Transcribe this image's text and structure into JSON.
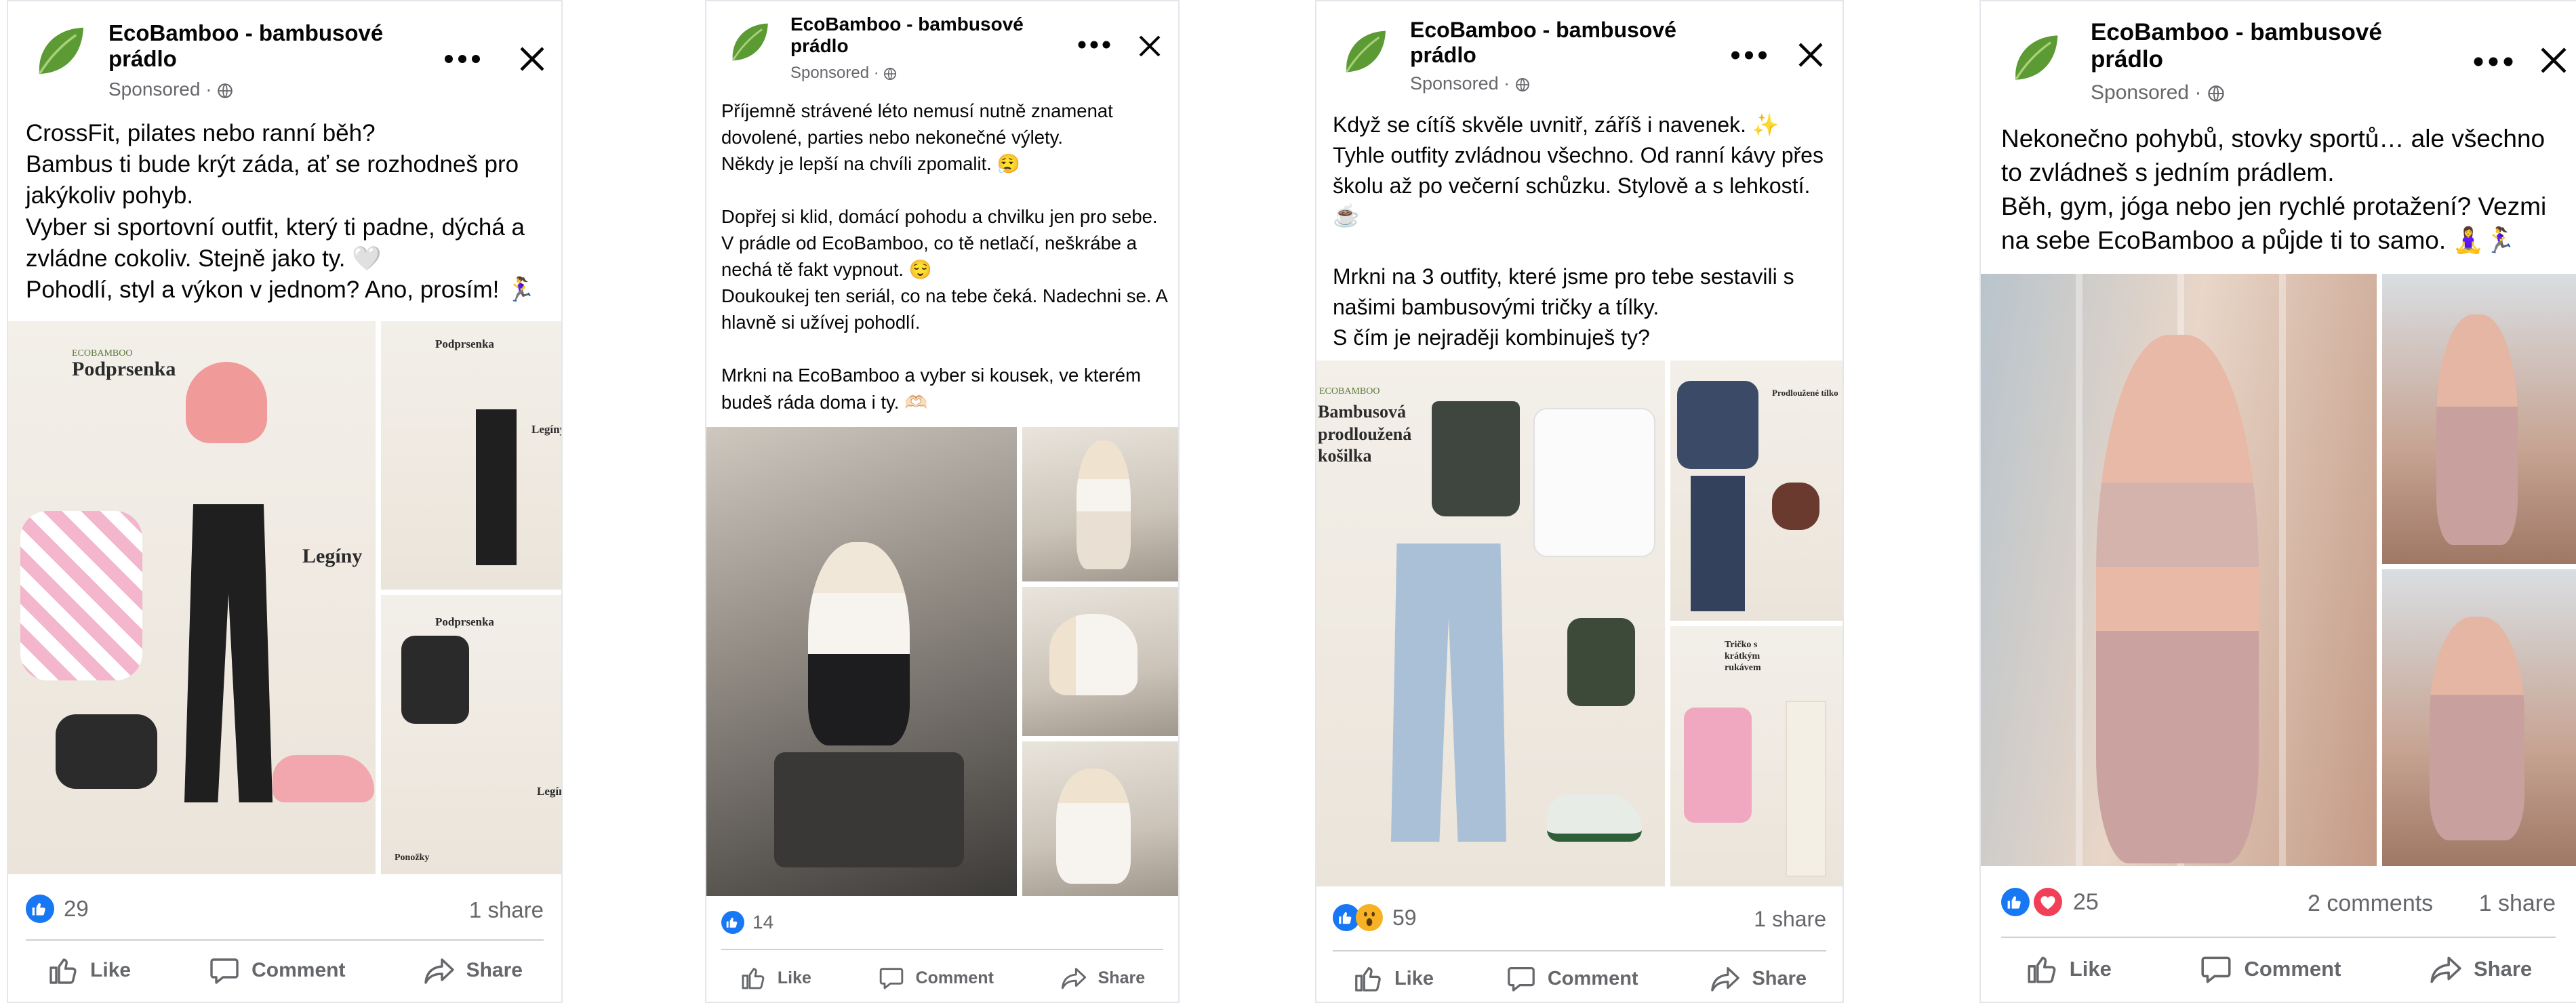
{
  "colors": {
    "like_blue": "#1877f2",
    "love_red": "#f33e58",
    "wow_yellow": "#f7b125",
    "muted_text": "#65676b",
    "divider": "#ced0d4",
    "brand_green": "#4e8a2f"
  },
  "icons": [
    "leaf-logo-icon",
    "globe-icon",
    "more-icon",
    "close-icon",
    "like-reaction-icon",
    "love-reaction-icon",
    "wow-reaction-icon",
    "thumbs-up-icon",
    "comment-icon",
    "share-icon"
  ],
  "actions": {
    "like": "Like",
    "comment": "Comment",
    "share": "Share"
  },
  "posts": [
    {
      "page_name": "EcoBamboo - bambusové prádlo",
      "sponsored": "Sponsored · ",
      "caption": "CrossFit, pilates nebo ranní běh?\nBambus ti bude krýt záda, ať se rozhodneš pro jakýkoliv pohyb.\nVyber si sportovní outfit, který ti padne, dýchá a zvládne cokoliv. Stejně jako ty. 🤍\nPohodlí, styl a výkon v jednom? Ano, prosím! 🏃‍♀️",
      "media_labels": {
        "a": "Podprsenka",
        "b": "Legíny",
        "c": "Podprsenka",
        "d": "Legíny",
        "e": "Podprsenka",
        "f": "Legíny",
        "g": "Ponožky",
        "brand": "ECOBAMBOO"
      },
      "reaction_count": "29",
      "shares": "1 share"
    },
    {
      "page_name": "EcoBamboo - bambusové prádlo",
      "sponsored": "Sponsored · ",
      "caption": "Příjemně strávené léto nemusí nutně znamenat dovolené, parties nebo nekonečné výlety.\nNěkdy je lepší na chvíli zpomalit. 😮‍💨\n\nDopřej si klid, domácí pohodu a chvilku jen pro sebe. V prádle od EcoBamboo, co tě netlačí, neškrábe a nechá tě fakt vypnout. 😌\nDoukoukej ten seriál, co na tebe čeká. Nadechni se. A hlavně si užívej pohodlí.\n\nMrkni na EcoBamboo a vyber si kousek, ve kterém budeš ráda doma i ty. 🫶🏻",
      "reaction_count": "14"
    },
    {
      "page_name": "EcoBamboo - bambusové prádlo",
      "sponsored": "Sponsored · ",
      "caption": "Když se cítíš skvěle uvnitř, záříš i navenek. ✨\nTyhle outfity zvládnou všechno. Od ranní kávy přes školu až po večerní schůzku. Stylově a s lehkostí. ☕\n\nMrkni na 3 outfity, které jsme pro tebe sestavili s našimi bambusovými tričky a tílky.\nS čím je nejraději kombinuješ ty?",
      "media_labels": {
        "a": "Bambusová prodloužená košilka",
        "b": "Prodloužené tílko",
        "c": "Tričko s krátkým rukávem",
        "brand": "ECOBAMBOO"
      },
      "reaction_count": "59",
      "shares": "1 share"
    },
    {
      "page_name": "EcoBamboo - bambusové prádlo",
      "sponsored": "Sponsored · ",
      "caption": "Nekonečno pohybů, stovky sportů… ale všechno to zvládneš s jedním prádlem.\nBěh, gym, jóga nebo jen rychlé protažení? Vezmi na sebe EcoBamboo a půjde ti to samo. 🧘‍♀️🏃‍♀️",
      "reaction_count": "25",
      "comments": "2 comments",
      "shares": "1 share"
    }
  ]
}
